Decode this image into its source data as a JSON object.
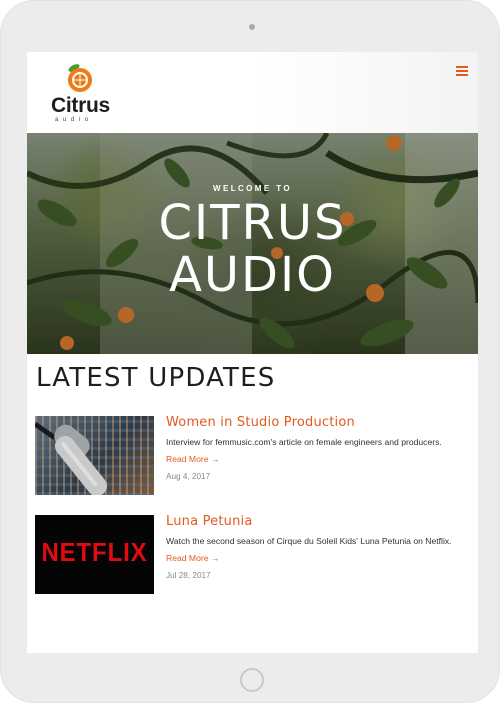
{
  "logo": {
    "word": "Citrus",
    "sub": "audio"
  },
  "header": {
    "menu_icon": "hamburger-menu-icon"
  },
  "hero": {
    "kicker": "WELCOME TO",
    "title_line1": "CITRUS",
    "title_line2": "AUDIO"
  },
  "updates": {
    "title": "LATEST UPDATES",
    "posts": [
      {
        "title": "Women in Studio Production",
        "description": "Interview for femmusic.com's article on female engineers and producers.",
        "read_more": "Read More →",
        "date": "Aug 4, 2017",
        "thumbnail": "microphone-mixing-desk-image"
      },
      {
        "title": "Luna Petunia",
        "description": "Watch the second season of Cirque du Soleil Kids' Luna Petunia on Netflix.",
        "read_more": "Read More →",
        "date": "Jul 28, 2017",
        "thumbnail": "netflix-logo-image",
        "thumbnail_text": "NETFLIX"
      }
    ]
  },
  "colors": {
    "accent": "#e25a20",
    "netflix_red": "#e50914"
  }
}
